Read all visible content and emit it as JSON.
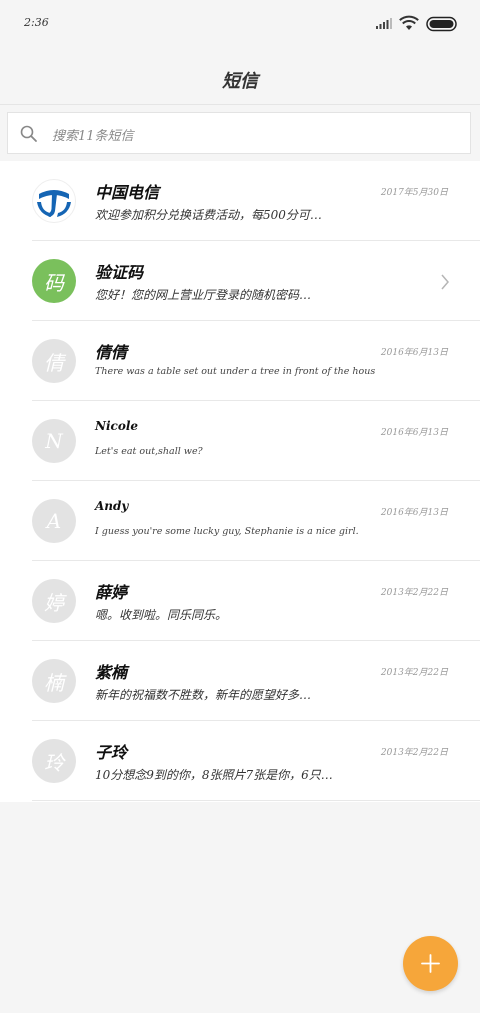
{
  "status_bar": {
    "time": "2:36"
  },
  "header": {
    "title": "短信"
  },
  "search": {
    "placeholder": "搜索11条短信"
  },
  "conversations": [
    {
      "name": "中国电信",
      "date": "2017年5月30日",
      "preview": "欢迎参加积分兑换话费活动，每500分可…",
      "avatar": "telecom-logo"
    },
    {
      "name": "验证码",
      "date": "",
      "preview": "您好！您的网上营业厅登录的随机密码…",
      "avatar_text": "码"
    },
    {
      "name": "倩倩",
      "date": "2016年6月13日",
      "preview": "There was a table set out under a tree in front of the hous",
      "avatar_text": "倩"
    },
    {
      "name": "Nicole",
      "date": "2016年6月13日",
      "preview": "Let's eat out,shall we?",
      "avatar_text": "N"
    },
    {
      "name": "Andy",
      "date": "2016年6月13日",
      "preview": "I guess you're some lucky guy, Stephanie is a nice girl.",
      "avatar_text": "A"
    },
    {
      "name": "薛婷",
      "date": "2013年2月22日",
      "preview": "嗯。收到啦。同乐同乐。",
      "avatar_text": "婷"
    },
    {
      "name": "紫楠",
      "date": "2013年2月22日",
      "preview": "新年的祝福数不胜数，新年的愿望好多…",
      "avatar_text": "楠"
    },
    {
      "name": "子玲",
      "date": "2013年2月22日",
      "preview": "10分想念9到的你，8张照片7张是你，6只…",
      "avatar_text": "玲"
    }
  ],
  "colors": {
    "fab": "#f6a63a",
    "verify_avatar": "#7ac05c",
    "telecom_blue": "#1565b4"
  }
}
